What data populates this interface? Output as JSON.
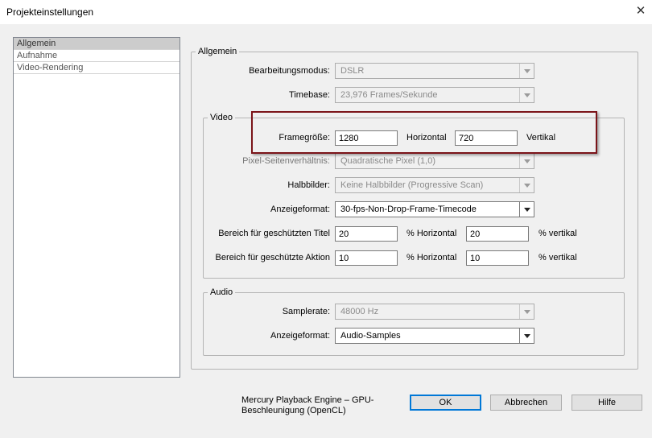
{
  "window": {
    "title": "Projekteinstellungen",
    "close_glyph": "✕"
  },
  "sidebar": {
    "items": [
      {
        "label": "Allgemein",
        "selected": true
      },
      {
        "label": "Aufnahme"
      },
      {
        "label": "Video-Rendering"
      }
    ]
  },
  "general": {
    "legend": "Allgemein",
    "edit_mode": {
      "label": "Bearbeitungsmodus:",
      "value": "DSLR"
    },
    "timebase": {
      "label": "Timebase:",
      "value": "23,976 Frames/Sekunde"
    }
  },
  "video": {
    "legend": "Video",
    "frame_size": {
      "label": "Framegröße:",
      "horizontal_value": "1280",
      "horizontal_label": "Horizontal",
      "vertical_value": "720",
      "vertical_label": "Vertikal"
    },
    "pixel_aspect": {
      "label": "Pixel-Seitenverhältnis:",
      "value": "Quadratische Pixel (1,0)"
    },
    "fields": {
      "label": "Halbbilder:",
      "value": "Keine Halbbilder (Progressive Scan)"
    },
    "display_format": {
      "label": "Anzeigeformat:",
      "value": "30-fps-Non-Drop-Frame-Timecode"
    },
    "title_safe": {
      "label": "Bereich für geschützten Titel",
      "horizontal_value": "20",
      "horizontal_label": "% Horizontal",
      "vertical_value": "20",
      "vertical_label": "% vertikal"
    },
    "action_safe": {
      "label": "Bereich für geschützte Aktion",
      "horizontal_value": "10",
      "horizontal_label": "% Horizontal",
      "vertical_value": "10",
      "vertical_label": "% vertikal"
    }
  },
  "audio": {
    "legend": "Audio",
    "sample_rate": {
      "label": "Samplerate:",
      "value": "48000 Hz"
    },
    "display_format": {
      "label": "Anzeigeformat:",
      "value": "Audio-Samples"
    }
  },
  "footer": {
    "engine_text": "Mercury Playback Engine – GPU-Beschleunigung (OpenCL)",
    "ok_label": "OK",
    "cancel_label": "Abbrechen",
    "help_label": "Hilfe"
  },
  "colors": {
    "highlight_border": "#7b1419",
    "default_button_border": "#0078d7"
  },
  "icons": {
    "dropdown": "chevron-down-icon",
    "close": "close-icon"
  }
}
